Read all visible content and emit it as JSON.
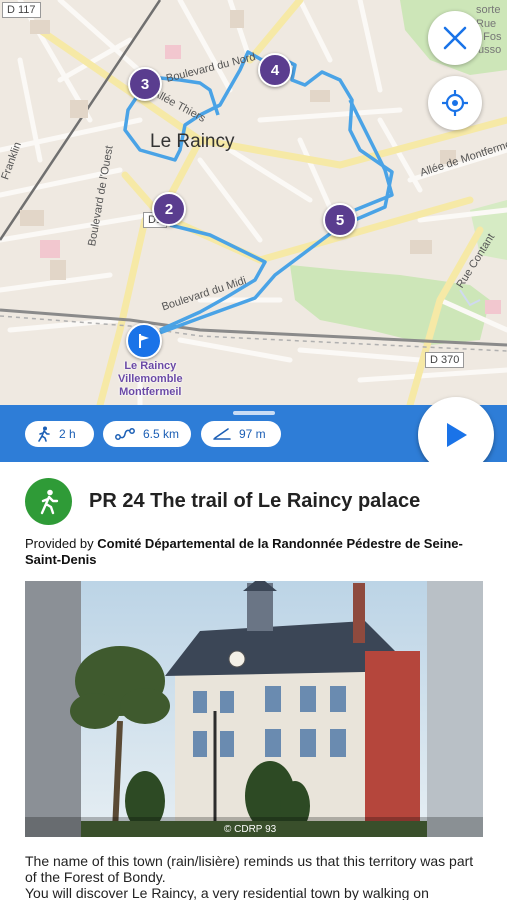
{
  "map": {
    "road_labels": {
      "d117": "D 117",
      "d370": "D 370",
      "d1": "D1",
      "boulevard_du_nord": "Boulevard du Nord",
      "allee_thiers": "Allée Thiers",
      "allee_montfermeil": "Allée de Montfermeil",
      "boulevard_ouest": "Boulevard de l'Ouest",
      "franklin": "Franklin",
      "boulevard_midi": "Boulevard du Midi",
      "rue_contant": "Rue Contant",
      "sorte": "sorte",
      "rue": "Rue",
      "forte": "e Fos",
      "busso": "usso"
    },
    "town_name": "Le Raincy",
    "station_label": [
      "Le Raincy",
      "Villemomble",
      "Montfermeil"
    ],
    "stops": [
      "2",
      "3",
      "4",
      "5"
    ],
    "route_color": "#4aa3e6",
    "marker_color": "#5a3d8f"
  },
  "controls": {
    "close_icon": "close-icon",
    "locate_icon": "crosshair-icon",
    "play_icon": "play-icon"
  },
  "stats": {
    "duration": "2 h",
    "distance": "6.5 km",
    "elevation": "97 m"
  },
  "trail": {
    "title": "PR 24 The trail of Le Raincy palace",
    "provided_by_prefix": "Provided by ",
    "provider": "Comité Départemental de la Randonnée Pédestre de Seine-Saint-Denis",
    "photo_credit": "© CDRP 93",
    "description_1": "The name of this town (rain/lisière) reminds us that this territory was part of the Forest of Bondy.",
    "description_2": "You will discover Le Raincy, a very residential town by walking on"
  },
  "colors": {
    "accent_blue": "#2e7dd7",
    "hike_green": "#2f9b37"
  }
}
